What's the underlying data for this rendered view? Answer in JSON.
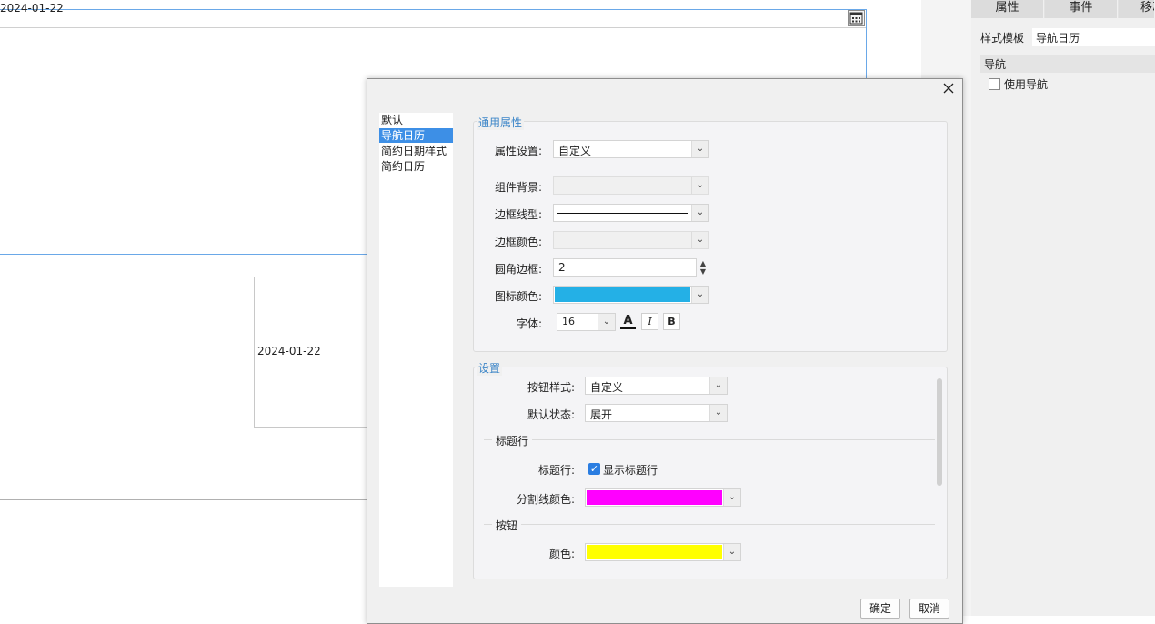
{
  "canvas": {
    "top_date": "2024-01-22",
    "mini_date": "2024-01-22"
  },
  "right_panel": {
    "tabs": [
      "属性",
      "事件",
      "移动"
    ],
    "style_template_label": "样式模板",
    "style_template_value": "导航日历",
    "nav_section": "导航",
    "use_nav_label": "使用导航",
    "use_nav_checked": false
  },
  "dialog": {
    "template_list": [
      "默认",
      "导航日历",
      "简约日期样式",
      "简约日历"
    ],
    "selected_template": "导航日历",
    "general": {
      "title": "通用属性",
      "attr_setting_label": "属性设置:",
      "attr_setting_value": "自定义",
      "bg_label": "组件背景:",
      "border_type_label": "边框线型:",
      "border_color_label": "边框颜色:",
      "radius_label": "圆角边框:",
      "radius_value": "2",
      "icon_color_label": "图标颜色:",
      "icon_color": "#24b0e6",
      "font_label": "字体:",
      "font_size": "16",
      "font_color_glyph": "A",
      "italic_glyph": "I",
      "bold_glyph": "B"
    },
    "settings": {
      "title": "设置",
      "button_style_label": "按钮样式:",
      "button_style_value": "自定义",
      "default_state_label": "默认状态:",
      "default_state_value": "展开",
      "title_row_section": "标题行",
      "title_row_label": "标题行:",
      "show_title_label": "显示标题行",
      "show_title_checked": true,
      "divider_color_label": "分割线颜色:",
      "divider_color": "#ff00ff",
      "button_section": "按钮",
      "color_label": "颜色:",
      "button_color": "#ffff00"
    },
    "ok_label": "确定",
    "cancel_label": "取消"
  }
}
